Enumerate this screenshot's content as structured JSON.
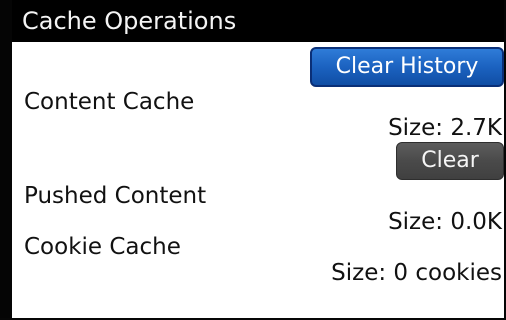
{
  "screen": {
    "title": "Cache Operations"
  },
  "actions": {
    "clear_history_label": "Clear History"
  },
  "caches": {
    "content": {
      "label": "Content Cache",
      "size": "Size: 2.7K",
      "clear_label": "Clear"
    },
    "pushed": {
      "label": "Pushed Content",
      "size": "Size: 0.0K"
    },
    "cookie": {
      "label": "Cookie Cache",
      "size": "Size: 0 cookies"
    }
  },
  "colors": {
    "title_bar": "#000000",
    "primary_button": "#1c63c1",
    "secondary_button": "#4a4a4a",
    "background": "#ffffff"
  }
}
